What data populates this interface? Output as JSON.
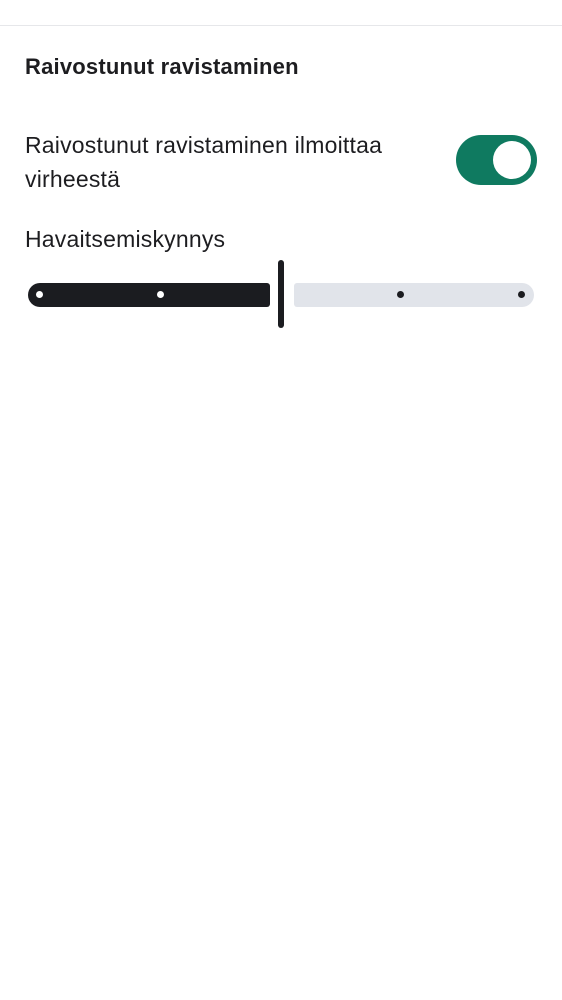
{
  "section": {
    "title": "Raivostunut ravistaminen"
  },
  "toggle": {
    "label": "Raivostunut ravistaminen ilmoittaa virheestä",
    "checked": true,
    "color_on": "#0f7a60"
  },
  "slider": {
    "label": "Havaitsemiskynnys",
    "min_step": 0,
    "max_step": 4,
    "value_step": 2,
    "active_color": "#1b1c20",
    "inactive_color": "#e1e4ea"
  }
}
